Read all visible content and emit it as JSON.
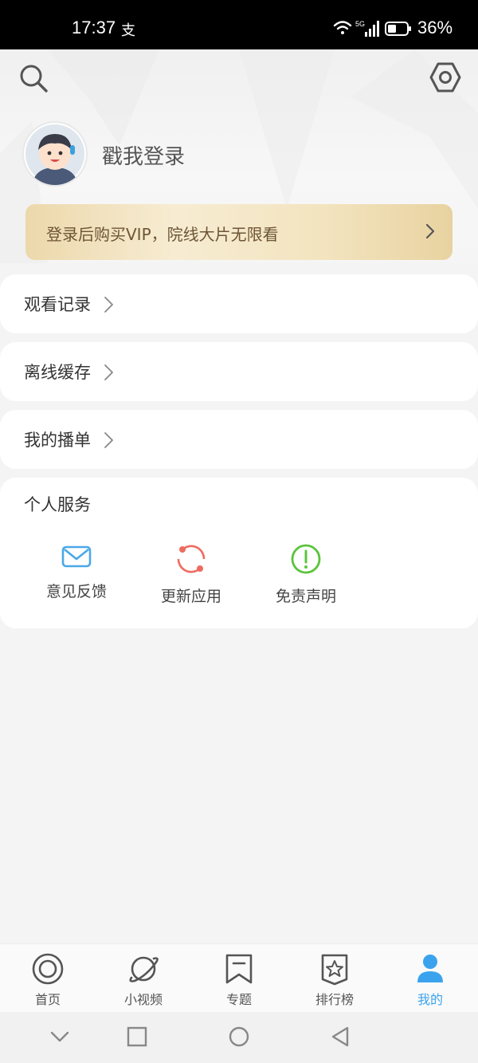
{
  "status_bar": {
    "time": "17:37",
    "pay_glyph": "支",
    "battery_pct": "36%",
    "network": "5G"
  },
  "header": {
    "login_text": "戳我登录",
    "vip_banner": "登录后购买VIP，院线大片无限看"
  },
  "menu": {
    "items": [
      {
        "label": "观看记录"
      },
      {
        "label": "离线缓存"
      },
      {
        "label": "我的播单"
      }
    ]
  },
  "services": {
    "title": "个人服务",
    "items": [
      {
        "label": "意见反馈",
        "icon": "envelope-icon",
        "color": "#4aa8e8"
      },
      {
        "label": "更新应用",
        "icon": "refresh-icon",
        "color": "#ee6b60"
      },
      {
        "label": "免责声明",
        "icon": "exclamation-icon",
        "color": "#5ac43c"
      }
    ]
  },
  "bottom_nav": {
    "items": [
      {
        "label": "首页",
        "icon": "home-circle-icon"
      },
      {
        "label": "小视频",
        "icon": "planet-icon"
      },
      {
        "label": "专题",
        "icon": "bookmark-icon"
      },
      {
        "label": "排行榜",
        "icon": "star-badge-icon"
      },
      {
        "label": "我的",
        "icon": "person-icon",
        "active": true
      }
    ],
    "active_color": "#3ba3ee"
  }
}
